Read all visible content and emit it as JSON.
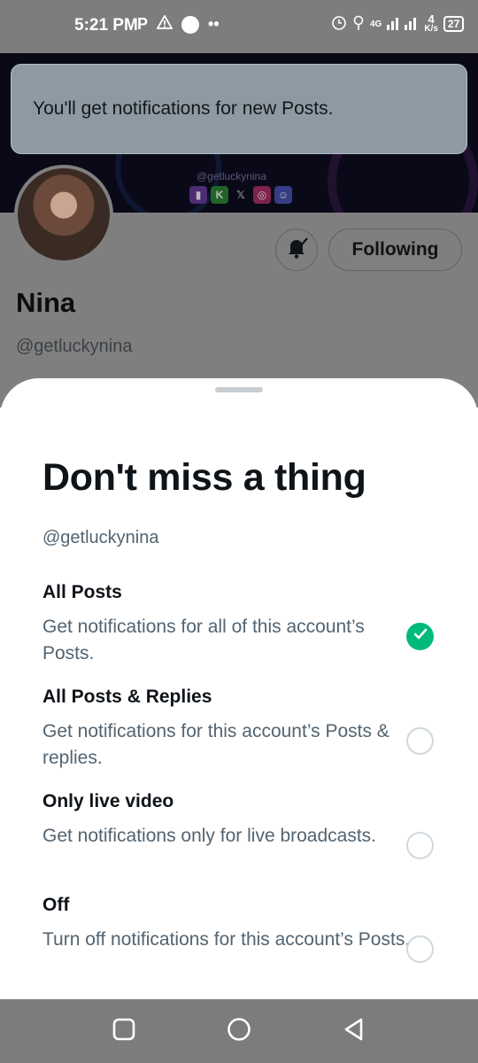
{
  "status_bar": {
    "time": "5:21 PM",
    "network_label": "4G",
    "speed_value": "4",
    "speed_unit": "K/s",
    "battery": "27"
  },
  "toast": {
    "message": "You'll get notifications for new Posts."
  },
  "profile": {
    "banner_handle": "@getluckynina",
    "name": "Nina",
    "handle": "@getluckynina",
    "following_label": "Following"
  },
  "sheet": {
    "title": "Don't miss a thing",
    "handle": "@getluckynina",
    "options": [
      {
        "title": "All Posts",
        "description": "Get notifications for all of this account’s Posts.",
        "selected": true
      },
      {
        "title": "All Posts & Replies",
        "description": "Get notifications for this account’s Posts & replies.",
        "selected": false
      },
      {
        "title": "Only live video",
        "description": "Get notifications only for live broadcasts.",
        "selected": false
      },
      {
        "title": "Off",
        "description": "Turn off notifications for this account’s Posts.",
        "selected": false
      }
    ]
  },
  "colors": {
    "selected_radio": "#00ba7c",
    "secondary_text": "#536471",
    "scrim": "#7f7f7f"
  },
  "icons": [
    "parking-icon",
    "warning-icon",
    "alarm-icon",
    "signal-icon",
    "battery-icon",
    "bell-check-icon",
    "check-icon",
    "recents-icon",
    "home-icon",
    "back-icon"
  ]
}
